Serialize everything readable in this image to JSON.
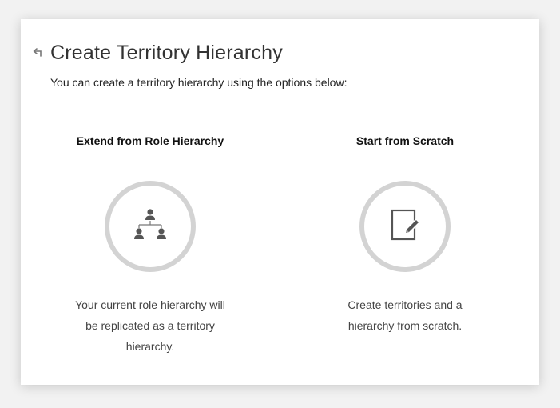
{
  "header": {
    "title": "Create Territory Hierarchy",
    "subtitle": "You can create a territory hierarchy using the options below:"
  },
  "options": [
    {
      "title": "Extend from Role Hierarchy",
      "icon": "org-chart-icon",
      "description": "Your current role hierarchy will be replicated as a territory hierarchy."
    },
    {
      "title": "Start from Scratch",
      "icon": "edit-document-icon",
      "description": "Create territories and a hierarchy from scratch."
    }
  ],
  "colors": {
    "circle_border": "#d3d3d3",
    "icon": "#555555",
    "title_text": "#333333"
  }
}
